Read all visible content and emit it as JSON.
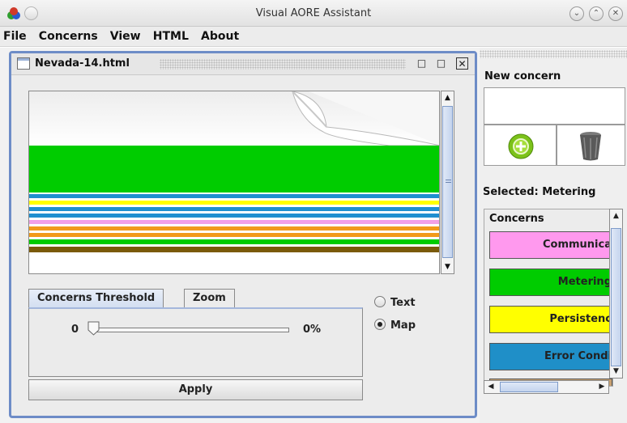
{
  "window": {
    "title": "Visual AORE Assistant",
    "controls": [
      "minimize-icon",
      "maximize-icon",
      "close-icon"
    ]
  },
  "menubar": {
    "items": [
      "File",
      "Concerns",
      "View",
      "HTML",
      "About"
    ]
  },
  "document": {
    "title": "Nevada-14.html",
    "view_mode": "Map",
    "map_stripe_colors": [
      "#00cc00",
      "#1f8fd0",
      "#ffff00",
      "#1f8fd0",
      "#f2a0e6",
      "#f29a1a",
      "#00cc00",
      "#7a5a0a"
    ]
  },
  "tabs": {
    "items": [
      "Concerns Threshold",
      "Zoom"
    ],
    "active": "Concerns Threshold"
  },
  "threshold": {
    "min_label": "0",
    "value_label": "0%",
    "value_fraction": 0
  },
  "apply_label": "Apply",
  "view_options": {
    "text_label": "Text",
    "map_label": "Map",
    "selected": "Map"
  },
  "right_panel": {
    "new_concern_label": "New concern",
    "new_concern_value": "",
    "add_icon": "add-icon",
    "trash_icon": "trash-icon",
    "selected_label": "Selected: Metering",
    "concerns_label": "Concerns",
    "concerns": [
      {
        "label": "Communica",
        "color": "#ff99ee"
      },
      {
        "label": "Metering",
        "color": "#00cc00"
      },
      {
        "label": "Persistenc",
        "color": "#ffff00"
      },
      {
        "label": "Error Condi",
        "color": "#1f8fc8"
      }
    ]
  }
}
